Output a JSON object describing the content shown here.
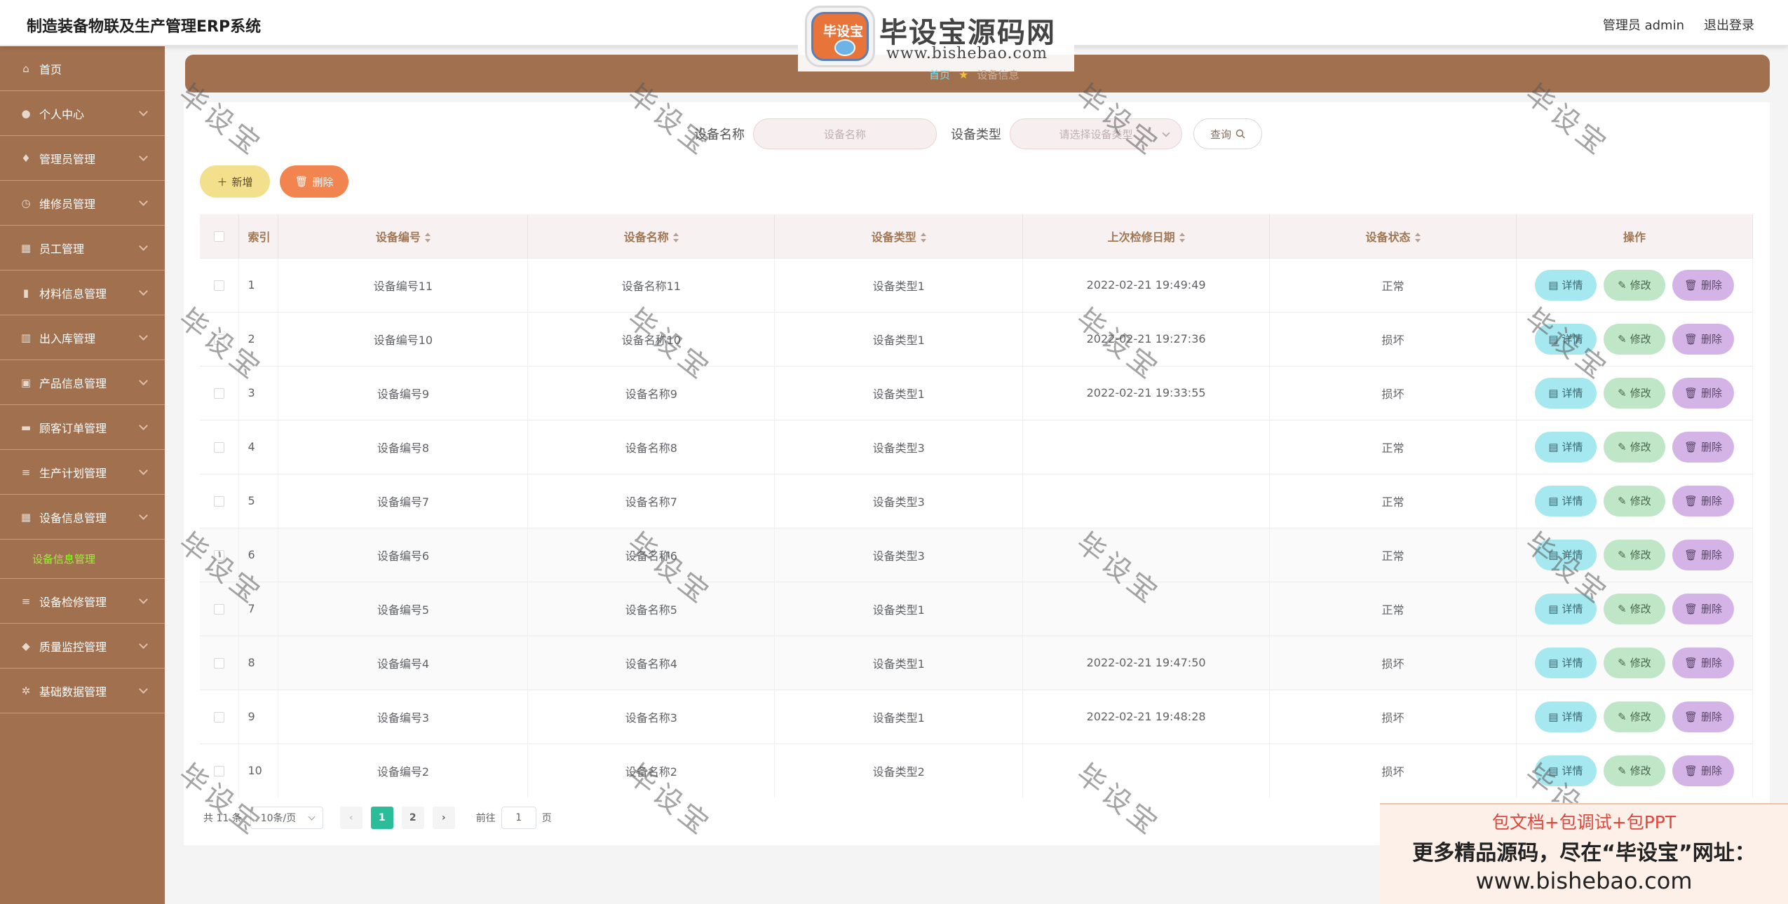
{
  "app": {
    "title": "制造装备物联及生产管理ERP系统",
    "user_label": "管理员 admin",
    "logout_label": "退出登录"
  },
  "logo": {
    "emblem_text": "毕设宝",
    "name": "毕设宝源码网",
    "url": "www.bishebao.com"
  },
  "sidebar": {
    "items": [
      {
        "label": "首页",
        "icon": "home-icon",
        "glyph": "⌂",
        "chevron": false
      },
      {
        "label": "个人中心",
        "icon": "user-icon",
        "glyph": "●",
        "chevron": true
      },
      {
        "label": "管理员管理",
        "icon": "mic-icon",
        "glyph": "♦",
        "chevron": true
      },
      {
        "label": "维修员管理",
        "icon": "clock-icon",
        "glyph": "◷",
        "chevron": true
      },
      {
        "label": "员工管理",
        "icon": "bank-icon",
        "glyph": "▦",
        "chevron": true
      },
      {
        "label": "材料信息管理",
        "icon": "database-icon",
        "glyph": "▮",
        "chevron": true
      },
      {
        "label": "出入库管理",
        "icon": "bar-chart-icon",
        "glyph": "▥",
        "chevron": true
      },
      {
        "label": "产品信息管理",
        "icon": "image-icon",
        "glyph": "▣",
        "chevron": true
      },
      {
        "label": "顾客订单管理",
        "icon": "monitor-icon",
        "glyph": "▬",
        "chevron": true
      },
      {
        "label": "生产计划管理",
        "icon": "list-icon",
        "glyph": "≡",
        "chevron": true
      },
      {
        "label": "设备信息管理",
        "icon": "grid-icon",
        "glyph": "▦",
        "chevron": true
      },
      {
        "label": "设备检修管理",
        "icon": "list-icon",
        "glyph": "≡",
        "chevron": true
      },
      {
        "label": "质量监控管理",
        "icon": "shield-icon",
        "glyph": "◆",
        "chevron": true
      },
      {
        "label": "基础数据管理",
        "icon": "gear-icon",
        "glyph": "✲",
        "chevron": true
      }
    ],
    "active_sub": "设备信息管理"
  },
  "breadcrumb": {
    "home": "首页",
    "current": "设备信息"
  },
  "search": {
    "name_label": "设备名称",
    "name_placeholder": "设备名称",
    "type_label": "设备类型",
    "type_placeholder": "请选择设备类型",
    "query_label": "查询"
  },
  "actions": {
    "add_label": "新增",
    "delete_label": "删除"
  },
  "table": {
    "columns": [
      "索引",
      "设备编号",
      "设备名称",
      "设备类型",
      "上次检修日期",
      "设备状态",
      "操作"
    ],
    "op_labels": {
      "detail": "详情",
      "edit": "修改",
      "remove": "删除"
    },
    "rows": [
      {
        "index": "1",
        "code": "设备编号11",
        "name": "设备名称11",
        "type": "设备类型1",
        "date": "2022-02-21 19:49:49",
        "status": "正常"
      },
      {
        "index": "2",
        "code": "设备编号10",
        "name": "设备名称10",
        "type": "设备类型1",
        "date": "2022-02-21 19:27:36",
        "status": "损坏"
      },
      {
        "index": "3",
        "code": "设备编号9",
        "name": "设备名称9",
        "type": "设备类型1",
        "date": "2022-02-21 19:33:55",
        "status": "损坏"
      },
      {
        "index": "4",
        "code": "设备编号8",
        "name": "设备名称8",
        "type": "设备类型3",
        "date": "",
        "status": "正常"
      },
      {
        "index": "5",
        "code": "设备编号7",
        "name": "设备名称7",
        "type": "设备类型3",
        "date": "",
        "status": "正常"
      },
      {
        "index": "6",
        "code": "设备编号6",
        "name": "设备名称6",
        "type": "设备类型3",
        "date": "",
        "status": "正常"
      },
      {
        "index": "7",
        "code": "设备编号5",
        "name": "设备名称5",
        "type": "设备类型1",
        "date": "",
        "status": "正常"
      },
      {
        "index": "8",
        "code": "设备编号4",
        "name": "设备名称4",
        "type": "设备类型1",
        "date": "2022-02-21 19:47:50",
        "status": "损坏"
      },
      {
        "index": "9",
        "code": "设备编号3",
        "name": "设备名称3",
        "type": "设备类型1",
        "date": "2022-02-21 19:48:28",
        "status": "损坏"
      },
      {
        "index": "10",
        "code": "设备编号2",
        "name": "设备名称2",
        "type": "设备类型2",
        "date": "",
        "status": "损坏"
      }
    ]
  },
  "pagination": {
    "total_label": "共 11 条",
    "page_size": "10条/页",
    "pages": [
      "1",
      "2"
    ],
    "current_page": "1",
    "goto_label": "前往",
    "goto_value": "1",
    "page_unit": "页"
  },
  "watermark": {
    "text": "毕设宝"
  },
  "ad_banner": {
    "line1": "包文档+包调试+包PPT",
    "line2": "更多精品源码，尽在“毕设宝”网址：",
    "line3": "www.bishebao.com"
  },
  "colors": {
    "sidebar_bg": "#a0704f",
    "active_sub": "#9ff03c",
    "page_active": "#2bbd9a",
    "btn_add": "#f3e08c",
    "btn_delete": "#f2854f",
    "op_detail": "#a6e8ef",
    "op_edit": "#bfe6c6",
    "op_remove": "#d4b4e6"
  }
}
